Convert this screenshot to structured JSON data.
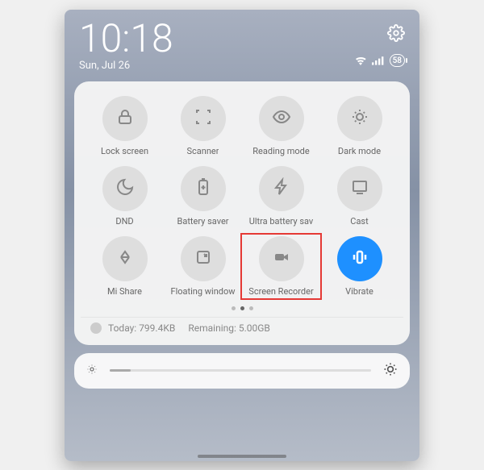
{
  "status": {
    "time": "10:18",
    "date": "Sun, Jul 26",
    "battery": "58"
  },
  "tiles": [
    {
      "label": "Lock screen"
    },
    {
      "label": "Scanner"
    },
    {
      "label": "Reading mode"
    },
    {
      "label": "Dark mode"
    },
    {
      "label": "DND"
    },
    {
      "label": "Battery saver"
    },
    {
      "label": "Ultra battery sav"
    },
    {
      "label": "Cast"
    },
    {
      "label": "Mi Share"
    },
    {
      "label": "Floating window"
    },
    {
      "label": "Screen Recorder"
    },
    {
      "label": "Vibrate"
    }
  ],
  "data_usage": {
    "today": "Today: 799.4KB",
    "remaining": "Remaining: 5.00GB"
  }
}
